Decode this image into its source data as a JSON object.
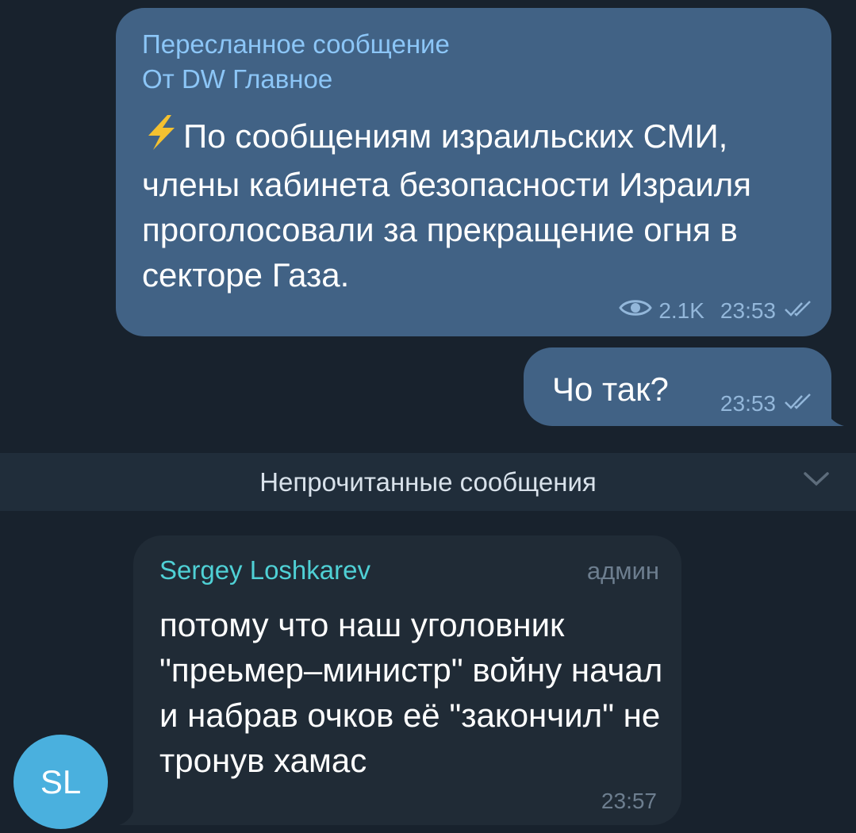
{
  "forwarded_message": {
    "label": "Пересланное сообщение",
    "from": "От DW Главное",
    "icon": "lightning-icon",
    "text": "По сообщениям израильских СМИ, члены кабинета безопасности Израиля проголосовали за прекращение огня в секторе Газа.",
    "views": "2.1K",
    "time": "23:53",
    "status_icon": "double-check-icon"
  },
  "reply_message": {
    "text": "Чо так?",
    "time": "23:53",
    "status_icon": "double-check-icon"
  },
  "unread_divider": {
    "label": "Непрочитанные сообщения",
    "icon": "chevron-down-icon"
  },
  "incoming_message": {
    "sender": "Sergey Loshkarev",
    "role": "админ",
    "text": "потому что наш уголовник \"преьмер–министр\" войну начал и набрав очков её \"закончил\" не тронув хамас",
    "time": "23:57",
    "avatar_initials": "SL",
    "avatar_color": "#4ab0de"
  },
  "colors": {
    "background": "#18222d",
    "outgoing_bubble": "#416285",
    "incoming_bubble": "#202b36",
    "accent_forward": "#8cc6f7",
    "sender_name": "#4fd0d5",
    "lightning": "#f4c130"
  }
}
